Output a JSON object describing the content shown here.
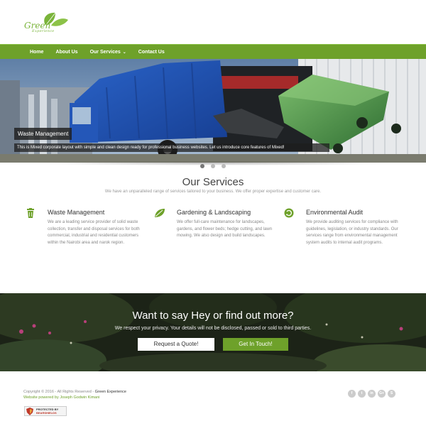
{
  "brand": {
    "logo_text": "Green",
    "logo_sub": "Experience",
    "accent_color": "#6ea12a"
  },
  "nav": {
    "items": [
      {
        "label": "Home"
      },
      {
        "label": "About Us"
      },
      {
        "label": "Our Services"
      },
      {
        "label": "Contact Us"
      }
    ]
  },
  "slider": {
    "caption_title": "Waste Management",
    "caption_text": "This is Mixed corporate layout with simple and clean design ready for professional business websites. Let us introduce core features of Mixed!",
    "slide_count": 3,
    "active_slide": 1
  },
  "services": {
    "title": "Our Services",
    "subtitle": "We have an unparalleled range of services tailored to your business. We offer proper expertise and customer care.",
    "items": [
      {
        "icon": "trash-bin-icon",
        "title": "Waste Management",
        "desc": "We are a leading service provider of solid waste collection, transfer and disposal services for both commercial, industrial and residential customers within the Nairobi area and narok region."
      },
      {
        "icon": "leaf-icon",
        "title": "Gardening & Landscaping",
        "desc": "We offer full-care maintenance for landscapes, gardens, and flower beds; hedge cutting, and lawn mowing. We also design and build landscapes."
      },
      {
        "icon": "recycle-icon",
        "title": "Environmental Audit",
        "desc": "We provide auditing services for compliance with guidelines, legislation, or industry standards. Our services range from environmental management system audits to internal audit programs."
      }
    ]
  },
  "cta": {
    "title": "Want to say Hey or find out more?",
    "subtitle": "We respect your privacy. Your details will not be disclosed, passed or sold to third parties.",
    "quote_button": "Request a Quote!",
    "touch_button": "Get In Touch!"
  },
  "footer": {
    "copyright_prefix": "Copyright © 2016 - All Rights Reserved - ",
    "copyright_brand": "Green Experience",
    "credit": "Website powered by Joseph Godwin Kimani",
    "socials": [
      {
        "icon": "facebook-icon",
        "glyph": "f"
      },
      {
        "icon": "twitter-icon",
        "glyph": "t"
      },
      {
        "icon": "linkedin-icon",
        "glyph": "in"
      },
      {
        "icon": "google-plus-icon",
        "glyph": "G+"
      },
      {
        "icon": "skype-icon",
        "glyph": "S"
      }
    ],
    "badge_line1": "PROTECTED BY",
    "badge_line2": "BEARSHIELDS"
  }
}
